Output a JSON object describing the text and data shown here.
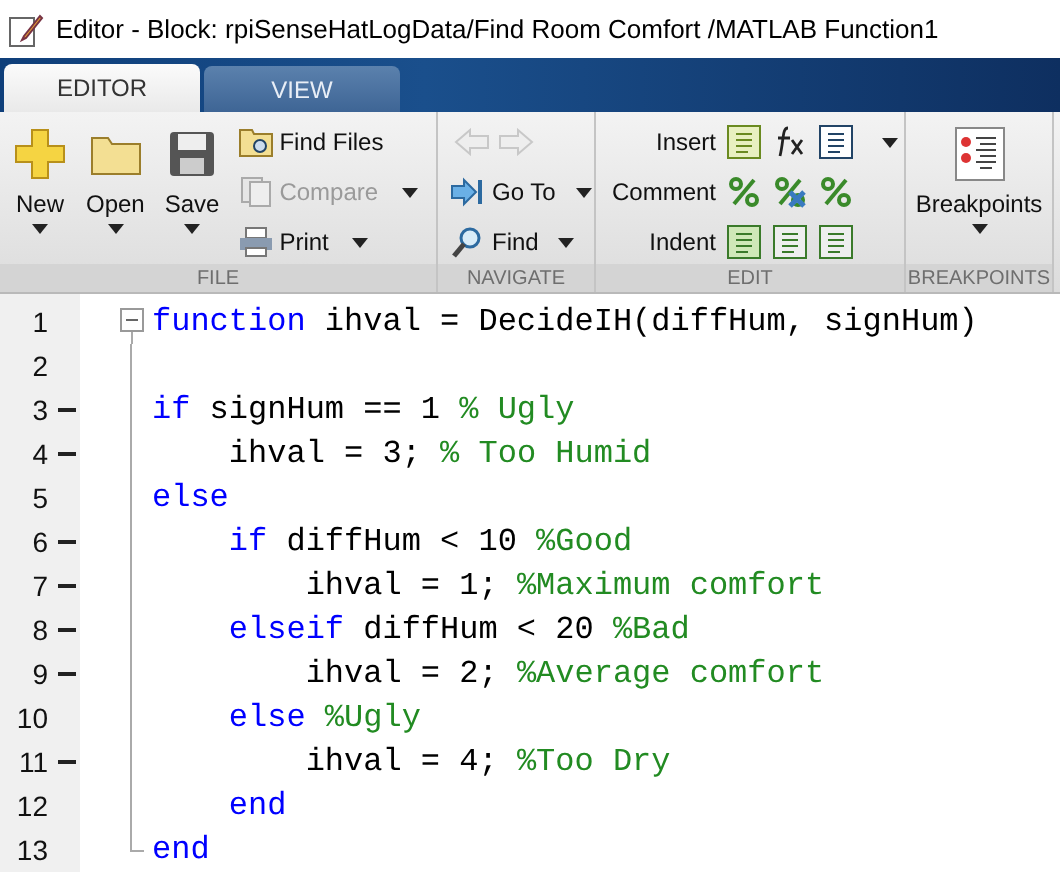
{
  "window": {
    "title": "Editor - Block: rpiSenseHatLogData/Find Room Comfort /MATLAB Function1"
  },
  "tabs": [
    {
      "label": "EDITOR",
      "selected": true
    },
    {
      "label": "VIEW",
      "selected": false
    }
  ],
  "sections": [
    {
      "kind": "file",
      "label": "FILE",
      "large": [
        {
          "label": "New",
          "caret": true
        },
        {
          "label": "Open",
          "caret": true
        },
        {
          "label": "Save",
          "caret": true
        }
      ],
      "small": [
        {
          "label": "Find Files",
          "caret": false,
          "disabled": false
        },
        {
          "label": "Compare",
          "caret": true,
          "disabled": true
        },
        {
          "label": "Print",
          "caret": true,
          "disabled": false
        }
      ]
    },
    {
      "kind": "navigate",
      "label": "NAVIGATE",
      "arrows_disabled": true,
      "small": [
        {
          "label": "Go To",
          "caret": true,
          "disabled": false
        },
        {
          "label": "Find",
          "caret": true,
          "disabled": false
        }
      ]
    },
    {
      "kind": "edit",
      "label": "EDIT",
      "rows": [
        {
          "label": "Insert",
          "caret": true
        },
        {
          "label": "Comment",
          "caret": false
        },
        {
          "label": "Indent",
          "caret": false
        }
      ]
    },
    {
      "kind": "breakpoints",
      "label": "BREAKPOINTS",
      "large": [
        {
          "label": "Breakpoints",
          "caret": true
        }
      ]
    }
  ],
  "code": [
    {
      "number": "1",
      "dash": false,
      "collapsible": true,
      "segments": [
        {
          "kind": "keyword",
          "text": "function"
        },
        {
          "kind": "plain",
          "text": " ihval = DecideIH(diffHum, signHum)"
        }
      ]
    },
    {
      "number": "2",
      "dash": false
    },
    {
      "number": "3",
      "dash": true,
      "segments": [
        {
          "kind": "keyword",
          "text": "if"
        },
        {
          "kind": "plain",
          "text": " signHum == 1 "
        },
        {
          "kind": "comment",
          "text": "% Ugly"
        }
      ]
    },
    {
      "number": "4",
      "dash": true,
      "segments": [
        {
          "kind": "plain",
          "text": "    ihval = 3; "
        },
        {
          "kind": "comment",
          "text": "% Too Humid"
        }
      ]
    },
    {
      "number": "5",
      "dash": false,
      "segments": [
        {
          "kind": "keyword",
          "text": "else"
        }
      ]
    },
    {
      "number": "6",
      "dash": true,
      "segments": [
        {
          "kind": "keyword",
          "text": "    if"
        },
        {
          "kind": "plain",
          "text": " diffHum < 10 "
        },
        {
          "kind": "comment",
          "text": "%Good"
        }
      ]
    },
    {
      "number": "7",
      "dash": true,
      "segments": [
        {
          "kind": "plain",
          "text": "        ihval = 1; "
        },
        {
          "kind": "comment",
          "text": "%Maximum comfort"
        }
      ]
    },
    {
      "number": "8",
      "dash": true,
      "segments": [
        {
          "kind": "keyword",
          "text": "    elseif"
        },
        {
          "kind": "plain",
          "text": " diffHum < 20 "
        },
        {
          "kind": "comment",
          "text": "%Bad"
        }
      ]
    },
    {
      "number": "9",
      "dash": true,
      "segments": [
        {
          "kind": "plain",
          "text": "        ihval = 2; "
        },
        {
          "kind": "comment",
          "text": "%Average comfort"
        }
      ]
    },
    {
      "number": "10",
      "dash": false,
      "segments": [
        {
          "kind": "keyword",
          "text": "    else"
        },
        {
          "kind": "comment",
          "text": " %Ugly"
        }
      ]
    },
    {
      "number": "11",
      "dash": true,
      "segments": [
        {
          "kind": "plain",
          "text": "        ihval = 4; "
        },
        {
          "kind": "comment",
          "text": "%Too Dry"
        }
      ]
    },
    {
      "number": "12",
      "dash": false,
      "segments": [
        {
          "kind": "keyword",
          "text": "    end"
        }
      ]
    },
    {
      "number": "13",
      "dash": false,
      "block_end": true,
      "segments": [
        {
          "kind": "keyword",
          "text": "end"
        }
      ]
    }
  ]
}
